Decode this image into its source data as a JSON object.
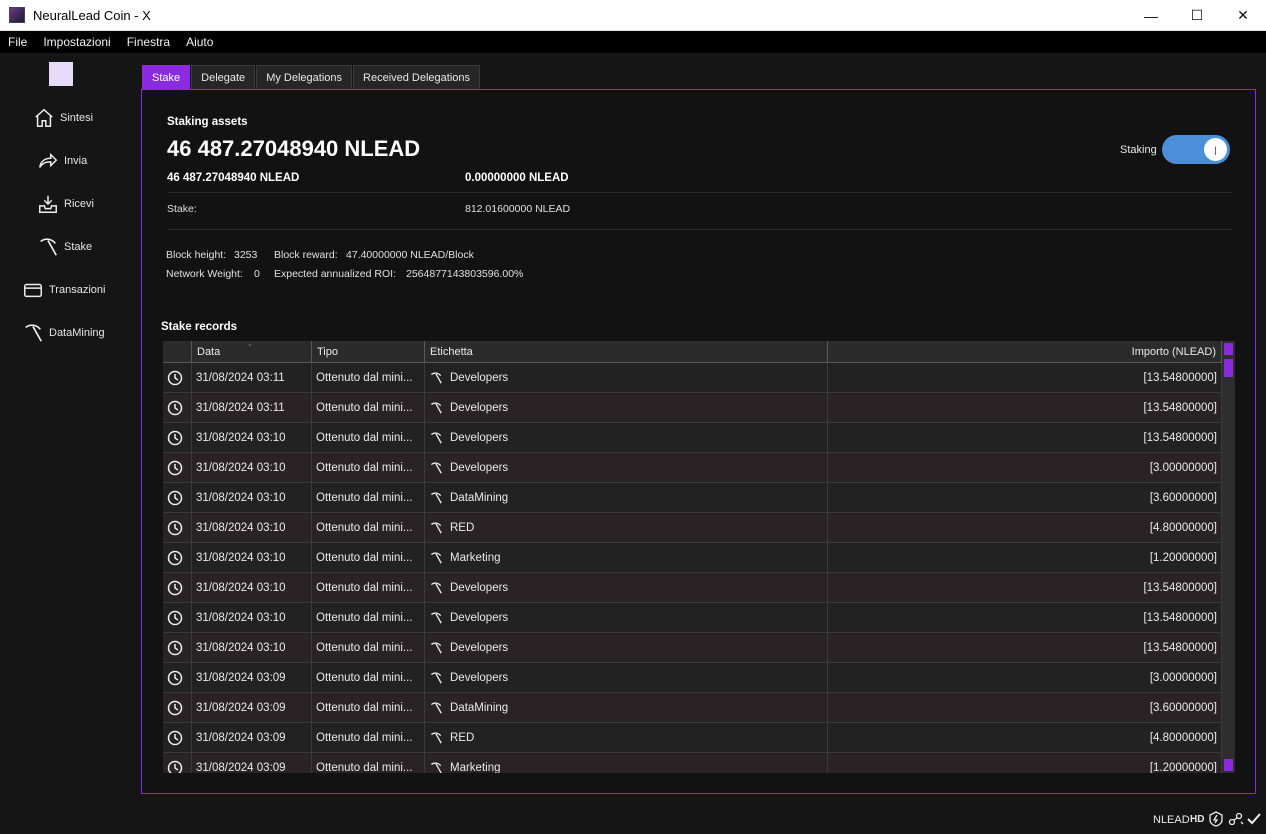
{
  "window": {
    "title": "NeuralLead Coin - X",
    "minimize": "—",
    "maximize": "☐",
    "close": "✕"
  },
  "menu": [
    "File",
    "Impostazioni",
    "Finestra",
    "Aiuto"
  ],
  "sidebar": {
    "items": [
      {
        "label": "Sintesi",
        "icon": "home-icon"
      },
      {
        "label": "Invia",
        "icon": "send-arrow-icon"
      },
      {
        "label": "Ricevi",
        "icon": "receive-tray-icon"
      },
      {
        "label": "Stake",
        "icon": "pickaxe-icon"
      },
      {
        "label": "Transazioni",
        "icon": "card-icon"
      },
      {
        "label": "DataMining",
        "icon": "pickaxe-icon"
      }
    ]
  },
  "tabs": [
    {
      "label": "Stake",
      "active": true
    },
    {
      "label": "Delegate",
      "active": false
    },
    {
      "label": "My Delegations",
      "active": false
    },
    {
      "label": "Received Delegations",
      "active": false
    }
  ],
  "staking": {
    "assets_label": "Staking assets",
    "total": "46 487.27048940 NLEAD",
    "available": "46 487.27048940 NLEAD",
    "other": "0.00000000 NLEAD",
    "stake_label": "Stake:",
    "stake_value": "812.01600000 NLEAD",
    "toggle_label": "Staking",
    "toggle_on": true
  },
  "network": {
    "block_height_label": "Block height:",
    "block_height": "3253",
    "block_reward_label": "Block reward:",
    "block_reward": "47.40000000 NLEAD/Block",
    "network_weight_label": "Network Weight:",
    "network_weight": "0",
    "roi_label": "Expected annualized ROI:",
    "roi": "2564877143803596.00%"
  },
  "records": {
    "title": "Stake records",
    "columns": [
      "",
      "Data",
      "Tipo",
      "Etichetta",
      "Importo (NLEAD)"
    ],
    "rows": [
      {
        "date": "31/08/2024 03:11",
        "type": "Ottenuto dal mini...",
        "label": "Developers",
        "amount": "[13.54800000]"
      },
      {
        "date": "31/08/2024 03:11",
        "type": "Ottenuto dal mini...",
        "label": "Developers",
        "amount": "[13.54800000]"
      },
      {
        "date": "31/08/2024 03:10",
        "type": "Ottenuto dal mini...",
        "label": "Developers",
        "amount": "[13.54800000]"
      },
      {
        "date": "31/08/2024 03:10",
        "type": "Ottenuto dal mini...",
        "label": "Developers",
        "amount": "[3.00000000]"
      },
      {
        "date": "31/08/2024 03:10",
        "type": "Ottenuto dal mini...",
        "label": "DataMining",
        "amount": "[3.60000000]"
      },
      {
        "date": "31/08/2024 03:10",
        "type": "Ottenuto dal mini...",
        "label": "RED",
        "amount": "[4.80000000]"
      },
      {
        "date": "31/08/2024 03:10",
        "type": "Ottenuto dal mini...",
        "label": "Marketing",
        "amount": "[1.20000000]"
      },
      {
        "date": "31/08/2024 03:10",
        "type": "Ottenuto dal mini...",
        "label": "Developers",
        "amount": "[13.54800000]"
      },
      {
        "date": "31/08/2024 03:10",
        "type": "Ottenuto dal mini...",
        "label": "Developers",
        "amount": "[13.54800000]"
      },
      {
        "date": "31/08/2024 03:10",
        "type": "Ottenuto dal mini...",
        "label": "Developers",
        "amount": "[13.54800000]"
      },
      {
        "date": "31/08/2024 03:09",
        "type": "Ottenuto dal mini...",
        "label": "Developers",
        "amount": "[3.00000000]"
      },
      {
        "date": "31/08/2024 03:09",
        "type": "Ottenuto dal mini...",
        "label": "DataMining",
        "amount": "[3.60000000]"
      },
      {
        "date": "31/08/2024 03:09",
        "type": "Ottenuto dal mini...",
        "label": "RED",
        "amount": "[4.80000000]"
      },
      {
        "date": "31/08/2024 03:09",
        "type": "Ottenuto dal mini...",
        "label": "Marketing",
        "amount": "[1.20000000]"
      }
    ]
  },
  "status": {
    "unit": "NLEAD",
    "hd": "HD"
  },
  "colors": {
    "accent": "#8a2be2",
    "toggle": "#4a8fd8",
    "background": "#151515"
  }
}
